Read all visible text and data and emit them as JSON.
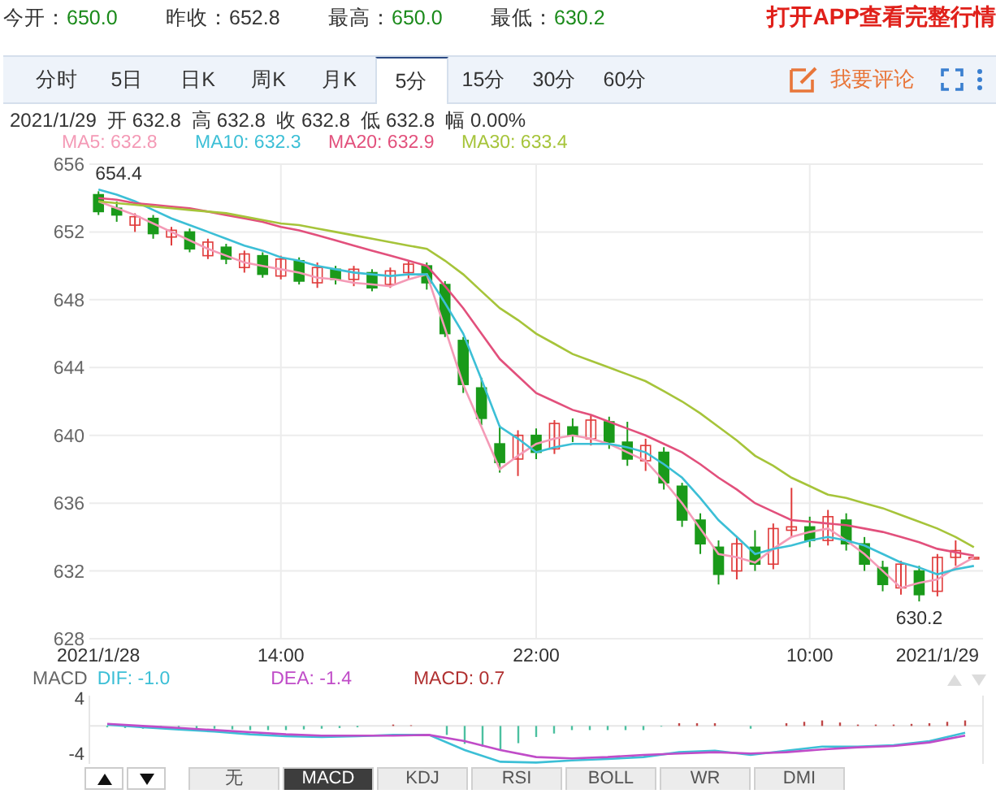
{
  "quote": [
    {
      "label": "今开：",
      "value": "650.0",
      "color": "#1a8a1a"
    },
    {
      "label": "昨收：",
      "value": "652.8",
      "color": "#333333"
    },
    {
      "label": "最高：",
      "value": "650.0",
      "color": "#1a8a1a"
    },
    {
      "label": "最低：",
      "value": "630.2",
      "color": "#1a8a1a"
    }
  ],
  "app_banner": "打开APP查看完整行情",
  "period_tabs": [
    {
      "label": "分时",
      "selected": false
    },
    {
      "label": "5日",
      "selected": false
    },
    {
      "label": "日K",
      "selected": false
    },
    {
      "label": "周K",
      "selected": false
    },
    {
      "label": "月K",
      "selected": false
    },
    {
      "label": "5分",
      "selected": true
    },
    {
      "label": "15分",
      "selected": false
    },
    {
      "label": "30分",
      "selected": false
    },
    {
      "label": "60分",
      "selected": false
    }
  ],
  "comment_button": "我要评论",
  "bar_info": "2021/1/29  开 632.8  高 632.8  收 632.8  低 632.8  幅 0.00%",
  "main_chart": {
    "legend": [
      {
        "label": "MA5: 632.8",
        "color": "#f49ab6"
      },
      {
        "label": "MA10: 632.3",
        "color": "#3cbfd6"
      },
      {
        "label": "MA20: 632.9",
        "color": "#e2507c"
      },
      {
        "label": "MA30: 633.4",
        "color": "#a6c43a"
      }
    ],
    "chart_data": {
      "type": "candlestick",
      "grid": true,
      "ylim": [
        628,
        656
      ],
      "yticks": [
        628,
        632,
        636,
        640,
        644,
        648,
        652,
        656
      ],
      "categories": [
        "2021/1/28",
        null,
        null,
        null,
        null,
        null,
        null,
        null,
        null,
        null,
        "14:00",
        null,
        null,
        null,
        null,
        null,
        null,
        null,
        null,
        null,
        null,
        null,
        null,
        null,
        "22:00",
        null,
        null,
        null,
        null,
        null,
        null,
        null,
        null,
        null,
        null,
        null,
        null,
        null,
        null,
        "10:00",
        null,
        null,
        null,
        null,
        null,
        null,
        "2021/1/29",
        null,
        null
      ],
      "ohlc": [
        [
          654.2,
          654.4,
          653.0,
          653.2
        ],
        [
          653.4,
          653.8,
          652.6,
          653.0
        ],
        [
          652.4,
          653.1,
          652.0,
          652.9
        ],
        [
          652.8,
          653.0,
          651.6,
          651.9
        ],
        [
          651.7,
          652.3,
          651.2,
          652.1
        ],
        [
          652.0,
          652.2,
          650.8,
          651.0
        ],
        [
          650.6,
          651.6,
          650.4,
          651.4
        ],
        [
          651.1,
          651.3,
          650.1,
          650.4
        ],
        [
          649.9,
          650.9,
          649.6,
          650.7
        ],
        [
          650.6,
          650.8,
          649.3,
          649.5
        ],
        [
          649.4,
          650.6,
          649.2,
          650.4
        ],
        [
          650.3,
          650.5,
          648.9,
          649.1
        ],
        [
          649.0,
          650.2,
          648.7,
          649.9
        ],
        [
          649.8,
          650.0,
          648.9,
          649.2
        ],
        [
          649.2,
          650.0,
          648.8,
          649.8
        ],
        [
          649.6,
          649.8,
          648.5,
          648.7
        ],
        [
          648.9,
          649.9,
          648.7,
          649.7
        ],
        [
          649.6,
          650.3,
          649.2,
          650.1
        ],
        [
          650.0,
          650.2,
          648.6,
          649.0
        ],
        [
          648.9,
          649.1,
          645.8,
          646.0
        ],
        [
          645.6,
          645.8,
          642.5,
          643.0
        ],
        [
          642.8,
          643.4,
          640.6,
          641.0
        ],
        [
          639.5,
          640.6,
          637.8,
          638.4
        ],
        [
          638.6,
          640.3,
          637.6,
          640.0
        ],
        [
          640.0,
          640.4,
          638.6,
          639.0
        ],
        [
          639.2,
          640.9,
          638.9,
          640.7
        ],
        [
          640.5,
          641.0,
          639.6,
          640.0
        ],
        [
          639.8,
          641.2,
          639.4,
          640.9
        ],
        [
          640.8,
          641.1,
          639.2,
          639.6
        ],
        [
          639.6,
          640.8,
          638.2,
          638.6
        ],
        [
          638.5,
          639.8,
          637.9,
          639.4
        ],
        [
          639.0,
          639.3,
          636.8,
          637.2
        ],
        [
          637.0,
          637.2,
          634.6,
          635.0
        ],
        [
          635.0,
          635.4,
          633.0,
          633.6
        ],
        [
          633.4,
          633.8,
          631.2,
          631.8
        ],
        [
          632.0,
          634.0,
          631.5,
          633.6
        ],
        [
          633.4,
          634.4,
          632.0,
          632.4
        ],
        [
          632.4,
          634.8,
          632.1,
          634.5
        ],
        [
          634.4,
          636.9,
          634.0,
          634.6
        ],
        [
          634.6,
          635.2,
          633.4,
          633.8
        ],
        [
          633.8,
          635.6,
          633.5,
          635.2
        ],
        [
          635.0,
          635.4,
          633.2,
          633.6
        ],
        [
          633.6,
          634.0,
          632.0,
          632.4
        ],
        [
          632.2,
          632.6,
          630.8,
          631.2
        ],
        [
          631.0,
          632.6,
          630.6,
          632.4
        ],
        [
          632.0,
          632.3,
          630.2,
          630.6
        ],
        [
          630.8,
          633.0,
          630.5,
          632.8
        ],
        [
          632.8,
          633.8,
          632.3,
          633.2
        ],
        [
          632.8,
          632.8,
          632.8,
          632.8
        ]
      ],
      "series": [
        {
          "type": "line",
          "color": "#f49ab6",
          "values": [
            653.8,
            653.4,
            653.0,
            652.5,
            652.0,
            651.5,
            651.0,
            650.6,
            650.2,
            650.0,
            649.8,
            649.6,
            649.3,
            649.2,
            649.0,
            648.9,
            648.8,
            649.2,
            649.5,
            646.3,
            643.0,
            640.5,
            638.0,
            638.8,
            639.5,
            639.8,
            640.0,
            639.8,
            639.5,
            639.0,
            638.5,
            637.3,
            636.0,
            634.5,
            633.0,
            632.8,
            632.5,
            633.3,
            634.0,
            634.3,
            634.5,
            633.8,
            633.0,
            632.0,
            631.0,
            631.3,
            631.5,
            632.2,
            632.8
          ]
        },
        {
          "type": "line",
          "color": "#3cbfd6",
          "values": [
            654.5,
            654.2,
            653.8,
            653.3,
            652.8,
            652.4,
            652.0,
            651.6,
            651.2,
            650.9,
            650.5,
            650.3,
            650.0,
            649.8,
            649.6,
            649.5,
            649.4,
            649.5,
            649.5,
            647.8,
            646.0,
            643.3,
            640.5,
            639.8,
            639.0,
            639.3,
            639.5,
            639.5,
            639.5,
            639.3,
            639.0,
            638.3,
            637.5,
            636.3,
            635.0,
            634.0,
            633.0,
            633.3,
            633.5,
            633.8,
            634.0,
            633.8,
            633.5,
            633.0,
            632.5,
            632.2,
            631.8,
            632.1,
            632.3
          ]
        },
        {
          "type": "line",
          "color": "#e2507c",
          "values": [
            654.0,
            653.9,
            653.7,
            653.6,
            653.5,
            653.4,
            653.2,
            653.0,
            652.8,
            652.6,
            652.3,
            652.1,
            651.8,
            651.5,
            651.2,
            650.9,
            650.6,
            650.3,
            650.0,
            648.8,
            647.5,
            646.0,
            644.5,
            643.5,
            642.5,
            642.0,
            641.5,
            641.2,
            640.8,
            640.4,
            640.0,
            639.5,
            639.0,
            638.3,
            637.5,
            636.8,
            636.0,
            635.5,
            635.0,
            634.9,
            634.8,
            634.7,
            634.5,
            634.3,
            634.0,
            633.7,
            633.3,
            633.1,
            632.9
          ]
        },
        {
          "type": "line",
          "color": "#a6c43a",
          "values": [
            653.8,
            653.7,
            653.6,
            653.5,
            653.4,
            653.3,
            653.2,
            653.1,
            652.9,
            652.7,
            652.5,
            652.4,
            652.2,
            652.0,
            651.8,
            651.6,
            651.4,
            651.2,
            651.0,
            650.3,
            649.5,
            648.5,
            647.5,
            646.8,
            646.0,
            645.4,
            644.8,
            644.4,
            644.0,
            643.6,
            643.2,
            642.6,
            642.0,
            641.3,
            640.5,
            639.7,
            638.8,
            638.2,
            637.5,
            637.0,
            636.5,
            636.3,
            636.0,
            635.7,
            635.3,
            634.9,
            634.5,
            634.0,
            633.4
          ]
        }
      ],
      "annotations": [
        "654.4",
        "630.2"
      ]
    }
  },
  "macd": {
    "title": "MACD",
    "legend": [
      {
        "label": "DIF: -1.0",
        "color": "#3cbfd6"
      },
      {
        "label": "DEA: -1.4",
        "color": "#c04cc8"
      },
      {
        "label": "MACD: 0.7",
        "color": "#b03030"
      }
    ],
    "chart_data": {
      "type": "line",
      "categories": [
        null,
        null,
        null,
        null,
        null,
        null,
        null,
        null,
        null,
        null,
        null,
        null,
        null,
        null,
        null,
        null,
        null,
        null,
        null,
        null,
        null,
        null,
        null,
        null,
        null
      ],
      "ylim": [
        -5.5,
        4.4
      ],
      "yticks": [
        -4,
        4
      ],
      "series": [
        {
          "color": "#3cbfd6",
          "values": [
            0.2,
            -0.2,
            -0.5,
            -0.8,
            -1.2,
            -1.5,
            -1.6,
            -1.5,
            -1.3,
            -1.3,
            -3.5,
            -5.2,
            -5.3,
            -5.0,
            -4.8,
            -4.5,
            -3.8,
            -3.6,
            -4.2,
            -3.6,
            -3.0,
            -3.0,
            -2.8,
            -2.2,
            -1.0
          ]
        },
        {
          "color": "#c04cc8",
          "values": [
            0.3,
            0.0,
            -0.3,
            -0.6,
            -0.9,
            -1.2,
            -1.4,
            -1.4,
            -1.4,
            -1.3,
            -2.2,
            -3.5,
            -4.5,
            -4.7,
            -4.5,
            -4.2,
            -4.0,
            -3.8,
            -4.0,
            -3.8,
            -3.4,
            -3.1,
            -2.9,
            -2.4,
            -1.4
          ]
        }
      ]
    }
  },
  "indicator_tabs": [
    {
      "label": "无",
      "selected": false
    },
    {
      "label": "MACD",
      "selected": true
    },
    {
      "label": "KDJ",
      "selected": false
    },
    {
      "label": "RSI",
      "selected": false
    },
    {
      "label": "BOLL",
      "selected": false
    },
    {
      "label": "WR",
      "selected": false
    },
    {
      "label": "DMI",
      "selected": false
    }
  ]
}
